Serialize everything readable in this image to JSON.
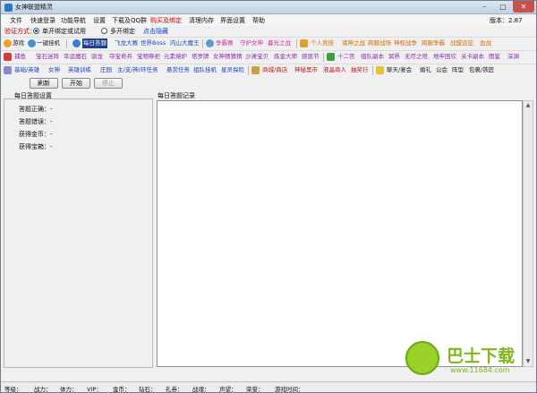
{
  "window": {
    "title": "女神联盟精灵",
    "min_glyph": "–",
    "max_glyph": "□",
    "close_glyph": "✕"
  },
  "menu": [
    {
      "label": "文件"
    },
    {
      "label": "快速登录"
    },
    {
      "label": "功能导航"
    },
    {
      "label": "设置"
    },
    {
      "label": "下载及QQ群"
    },
    {
      "label": "购买及绑定"
    },
    {
      "label": "清理内存"
    },
    {
      "label": "界面设置"
    },
    {
      "label": "帮助"
    }
  ],
  "version": "版本：2.87",
  "verify": {
    "label": "验证方式：",
    "option1": "单开绑定或试用",
    "option2": "多开绑定",
    "hide_link": "点击隐藏"
  },
  "row1": {
    "games": "游戏",
    "one_click": "一键挂机",
    "items": [
      "每日答题",
      "飞龙大赛",
      "世界Boss",
      "内山大魔王",
      "争霸赛",
      "守护女神",
      "暮光之战",
      "个人竞技",
      "诸神之战",
      "跨服战场",
      "神权战争",
      "跨服争霸",
      "战盟远征",
      "血战"
    ]
  },
  "row2": {
    "items": [
      "捕鱼",
      "宝石迷阵",
      "幸运魔石",
      "驯龙",
      "夺宝奇兵",
      "宝物祭祀",
      "元素熔炉",
      "塔罗牌",
      "女神猜猜猜",
      "沙滩宝贝",
      "炼金大师",
      "感恩节",
      "十二宫",
      "组队副本",
      "冥界",
      "无尽之塔",
      "地牢困坎",
      "关卡副本",
      "图鉴",
      "深渊"
    ]
  },
  "row3": {
    "items": [
      "基础/英雄",
      "女神",
      "英雄训练",
      "庄园",
      "主/支/神/环任务",
      "悬赏任务",
      "组队挂机",
      "星灵探险",
      "商城/商店",
      "神秘黑市",
      "液晶商人",
      "抽奖行",
      "聊天/宴会",
      "婚礼",
      "公会",
      "阵型",
      "包裹/铁匠"
    ]
  },
  "buttons": {
    "refresh": "刷新",
    "start": "开始",
    "stop": "停止"
  },
  "left_panel": {
    "title": "每日答题设置",
    "stats": [
      {
        "label": "答题正确：",
        "value": "-"
      },
      {
        "label": "答题错误：",
        "value": "-"
      },
      {
        "label": "获得金币：",
        "value": "-"
      },
      {
        "label": "获得宝箱：",
        "value": "-"
      }
    ]
  },
  "log_panel": {
    "title": "每日答题记录"
  },
  "status": [
    {
      "label": "等级："
    },
    {
      "label": "战力："
    },
    {
      "label": "体力："
    },
    {
      "label": "VIP："
    },
    {
      "label": "金币："
    },
    {
      "label": "钻石："
    },
    {
      "label": "礼券："
    },
    {
      "label": "战魂："
    },
    {
      "label": "声望："
    },
    {
      "label": "荣誉："
    },
    {
      "label": "游戏时间："
    }
  ],
  "watermark": {
    "text": "巴士下载",
    "url": "www.11684.com"
  },
  "colors": {
    "selected_tab": "#1f3f8a",
    "close_button": "#c9514b",
    "verify_label": "#c00000",
    "link": "#1040d0",
    "watermark": "#7fb61a"
  }
}
